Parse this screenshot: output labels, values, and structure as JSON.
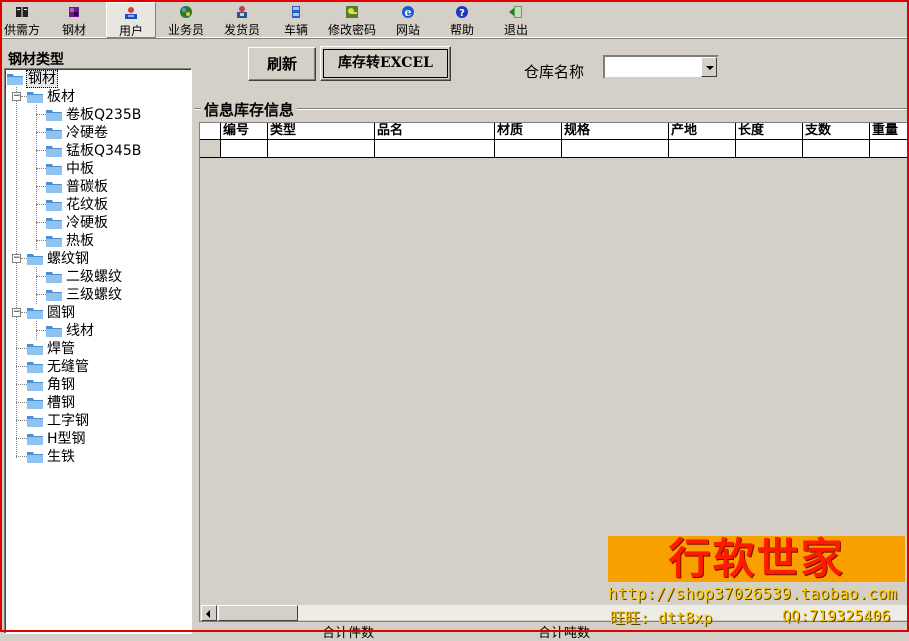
{
  "toolbar": {
    "items": [
      {
        "label": "供需方",
        "icon": "book-icon"
      },
      {
        "label": "钢材",
        "icon": "steel-icon"
      },
      {
        "label": "用户",
        "icon": "user-icon"
      },
      {
        "label": "业务员",
        "icon": "salesman-icon"
      },
      {
        "label": "发货员",
        "icon": "shipper-icon"
      },
      {
        "label": "车辆",
        "icon": "vehicle-icon"
      },
      {
        "label": "修改密码",
        "icon": "password-icon"
      },
      {
        "label": "网站",
        "icon": "ie-icon"
      },
      {
        "label": "帮助",
        "icon": "help-icon"
      },
      {
        "label": "退出",
        "icon": "exit-icon"
      }
    ],
    "active_index": 2
  },
  "left": {
    "title": "钢材类型",
    "tree": {
      "root": "钢材",
      "n1": "板材",
      "n1_1": "卷板Q235B",
      "n1_2": "冷硬卷",
      "n1_3": "锰板Q345B",
      "n1_4": "中板",
      "n1_5": "普碳板",
      "n1_6": "花纹板",
      "n1_7": "冷硬板",
      "n1_8": "热板",
      "n2": "螺纹钢",
      "n2_1": "二级螺纹",
      "n2_2": "三级螺纹",
      "n3": "圆钢",
      "n3_1": "线材",
      "n4": "焊管",
      "n5": "无缝管",
      "n6": "角钢",
      "n7": "槽钢",
      "n8": "工字钢",
      "n9": "H型钢",
      "n10": "生铁"
    }
  },
  "main": {
    "refresh_label": "刷新",
    "export_label": "库存转EXCEL",
    "warehouse_label": "仓库名称",
    "warehouse_value": "",
    "group_title": "信息库存信息",
    "columns": [
      "编号",
      "类型",
      "品名",
      "材质",
      "规格",
      "产地",
      "长度",
      "支数",
      "重量"
    ],
    "footer_left": "合计件数",
    "footer_right": "合计吨数"
  },
  "watermark": {
    "title": "行软世家",
    "url": "http://shop37026539.taobao.com",
    "wangwang": "旺旺: dtt8xp",
    "qq": "QQ:719325406"
  }
}
